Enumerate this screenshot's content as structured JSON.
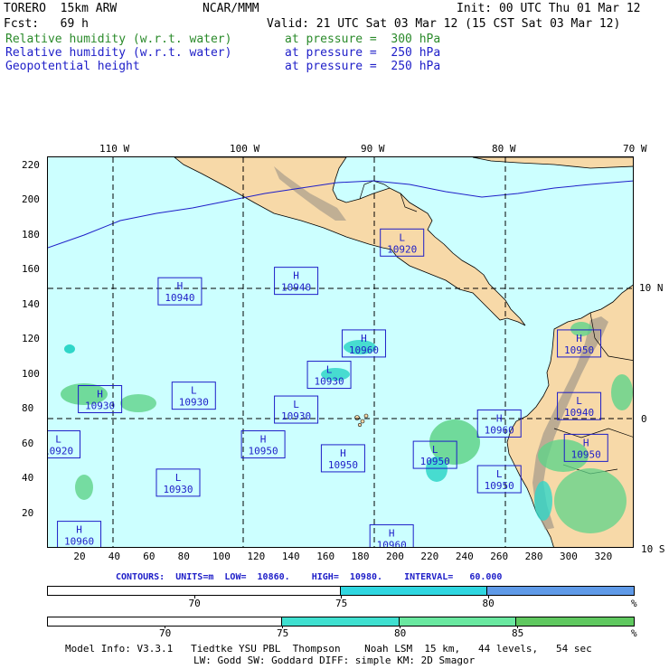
{
  "header": {
    "model": "TORERO  15km ARW",
    "org": "NCAR/MMM",
    "init": "Init: 00 UTC Thu 01 Mar 12",
    "fcst": "Fcst:   69 h",
    "valid": "Valid: 21 UTC Sat 03 Mar 12 (15 CST Sat 03 Mar 12)",
    "fields": [
      {
        "name": "Relative humidity (w.r.t. water)",
        "level": "at pressure =  300 hPa",
        "color": "#2a8a2a"
      },
      {
        "name": "Relative humidity (w.r.t. water)",
        "level": "at pressure =  250 hPa",
        "color": "#1e1ec8"
      },
      {
        "name": "Geopotential height",
        "level": "at pressure =  250 hPa",
        "color": "#1e1ec8"
      }
    ]
  },
  "map": {
    "lon_labels": [
      "110 W",
      "100 W",
      "90 W",
      "80 W",
      "70 W"
    ],
    "lat_labels": [
      "10 N",
      "0",
      "10 S"
    ],
    "y_ticks": [
      "220",
      "200",
      "180",
      "160",
      "140",
      "120",
      "100",
      "80",
      "60",
      "40",
      "20"
    ],
    "x_ticks": [
      "20",
      "40",
      "60",
      "80",
      "100",
      "120",
      "140",
      "160",
      "180",
      "200",
      "220",
      "240",
      "260",
      "280",
      "300",
      "320"
    ],
    "colors": {
      "ocean": "#ccffff",
      "land": "#f7d9a8",
      "terrain": "#a89c8c",
      "rh_green": "#5fd38a",
      "rh_cyan": "#2fd6c8",
      "rh_blue": "#5f9ae8",
      "contour": "#1e1ec8"
    },
    "centers": [
      {
        "type": "L",
        "value": "10920",
        "gx": 204,
        "gy": 176
      },
      {
        "type": "H",
        "value": "10940",
        "gx": 76,
        "gy": 148
      },
      {
        "type": "H",
        "value": "10940",
        "gx": 143,
        "gy": 154
      },
      {
        "type": "H",
        "value": "10960",
        "gx": 182,
        "gy": 118
      },
      {
        "type": "L",
        "value": "10930",
        "gx": 162,
        "gy": 100
      },
      {
        "type": "L",
        "value": "10930",
        "gx": 143,
        "gy": 80
      },
      {
        "type": "H",
        "value": "10930",
        "gx": 30,
        "gy": 86
      },
      {
        "type": "L",
        "value": "10930",
        "gx": 84,
        "gy": 88
      },
      {
        "type": "L",
        "value": "10920",
        "gx": 6,
        "gy": 60
      },
      {
        "type": "H",
        "value": "10950",
        "gx": 124,
        "gy": 60
      },
      {
        "type": "L",
        "value": "10930",
        "gx": 75,
        "gy": 38
      },
      {
        "type": "H",
        "value": "10950",
        "gx": 170,
        "gy": 52
      },
      {
        "type": "L",
        "value": "10950",
        "gx": 223,
        "gy": 54
      },
      {
        "type": "H",
        "value": "10960",
        "gx": 260,
        "gy": 72
      },
      {
        "type": "L",
        "value": "10950",
        "gx": 260,
        "gy": 40
      },
      {
        "type": "H",
        "value": "10950",
        "gx": 306,
        "gy": 118
      },
      {
        "type": "L",
        "value": "10940",
        "gx": 306,
        "gy": 82
      },
      {
        "type": "H",
        "value": "10950",
        "gx": 310,
        "gy": 58
      },
      {
        "type": "H",
        "value": "10960",
        "gx": 18,
        "gy": 8
      },
      {
        "type": "H",
        "value": "10960",
        "gx": 198,
        "gy": 6
      }
    ]
  },
  "contours": {
    "text": "CONTOURS:  UNITS=m  LOW=  10860.    HIGH=  10980.    INTERVAL=   60.000"
  },
  "colorbar1": {
    "segments": [
      {
        "color": "#ffffff",
        "w": 0.5
      },
      {
        "color": "#2fd6e0",
        "w": 0.25
      },
      {
        "color": "#5f9ae8",
        "w": 0.25
      }
    ],
    "labels": [
      "70",
      "75",
      "80"
    ],
    "unit": "%"
  },
  "colorbar2": {
    "segments": [
      {
        "color": "#ffffff",
        "w": 0.4
      },
      {
        "color": "#3fe0d0",
        "w": 0.2
      },
      {
        "color": "#6ae8a0",
        "w": 0.2
      },
      {
        "color": "#5fc85f",
        "w": 0.2
      }
    ],
    "labels": [
      "70",
      "75",
      "80",
      "85"
    ],
    "unit": "%"
  },
  "footer": {
    "line1": "Model Info: V3.3.1   Tiedtke YSU PBL  Thompson    Noah LSM  15 km,   44 levels,   54 sec",
    "line2": "LW: Godd SW: Goddard DIFF: simple KM: 2D Smagor"
  }
}
